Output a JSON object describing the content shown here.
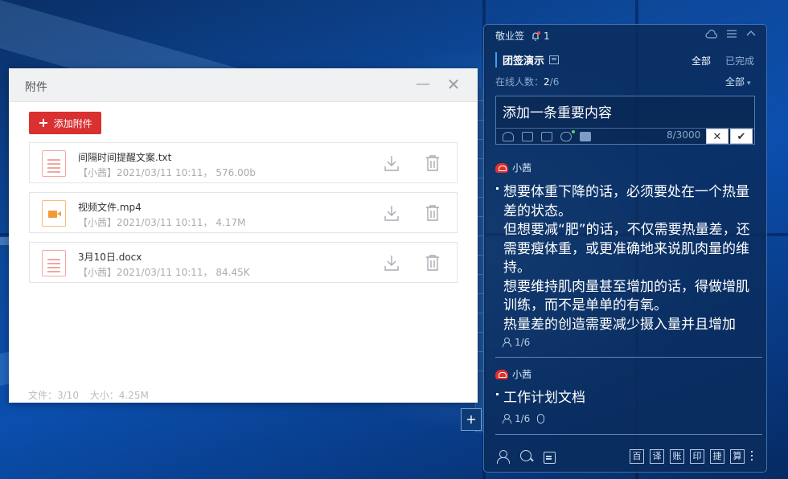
{
  "attachment_window": {
    "title": "附件",
    "add_button": "添加附件",
    "files": [
      {
        "name": "间隔时间提醒文案.txt",
        "meta": "【小茜】2021/03/11 10:11， 576.00b",
        "type": "doc"
      },
      {
        "name": "视频文件.mp4",
        "meta": "【小茜】2021/03/11 10:11， 4.17M",
        "type": "video"
      },
      {
        "name": "3月10日.docx",
        "meta": "【小茜】2021/03/11 10:11， 84.45K",
        "type": "doc"
      }
    ],
    "footer_count": "文件：3/10",
    "footer_size": "大小：4.25M"
  },
  "side_add": "+",
  "note_panel": {
    "app_name": "敬业签",
    "notification_count": "1",
    "group_name": "团签演示",
    "filter_all": "全部",
    "filter_done": "已完成",
    "online_label": "在线人数：",
    "online_current": "2",
    "online_total": "/6",
    "member_filter": "全部",
    "input_text": "添加一条重要内容",
    "char_count": "8/3000",
    "cancel_symbol": "✕",
    "confirm_symbol": "✔",
    "notes": [
      {
        "author": "小茜",
        "text": "想要体重下降的话，必须要处在一个热量差的状态。\n但想要减“肥”的话，不仅需要热量差，还需要瘦体重，或更准确地来说肌肉量的维持。\n想要维持肌肉量甚至增加的话，得做增肌训练，而不是单单的有氧。\n热量差的创造需要减少摄入量并且增加",
        "read": "1/6"
      },
      {
        "author": "小茜",
        "text": "工作计划文档",
        "read": "1/6"
      }
    ],
    "bottom_tools": [
      "百",
      "译",
      "账",
      "印",
      "捷",
      "算"
    ]
  },
  "colors": {
    "add_button": "#d93030",
    "panel_bg": "#0a2c5c",
    "accent": "#3aa0ff",
    "avatar": "#e0302c"
  },
  "icons": [
    "bell-icon",
    "cloud-icon",
    "menu-icon",
    "collapse-icon",
    "download-icon",
    "trash-icon",
    "user-icon",
    "image-icon",
    "sound-icon",
    "paperclip-icon",
    "square-icon",
    "users-icon",
    "search-icon",
    "calendar-icon",
    "more-icon"
  ]
}
